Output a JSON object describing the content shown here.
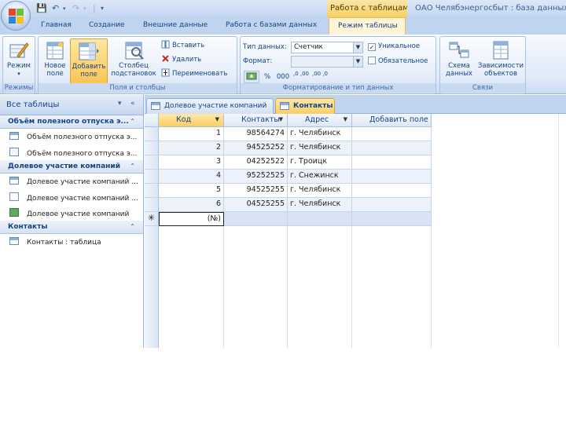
{
  "title_bar": {
    "context_title": "Работа с таблицами",
    "app_title": "ОАО Челябэнергосбыт : база данных"
  },
  "ribbon_tabs": [
    "Главная",
    "Создание",
    "Внешние данные",
    "Работа с базами данных"
  ],
  "active_tab": "Режим таблицы",
  "groups": {
    "views": {
      "label": "Режимы",
      "mode_button": "Режим"
    },
    "fields": {
      "label": "Поля и столбцы",
      "new_field_1": "Новое",
      "new_field_2": "поле",
      "add_field_1": "Добавить",
      "add_field_2": "поле",
      "lookup_1": "Столбец",
      "lookup_2": "подстановок",
      "insert": "Вставить",
      "delete": "Удалить",
      "rename": "Переименовать"
    },
    "formatting": {
      "label": "Форматирование и тип данных",
      "datatype_label": "Тип данных:",
      "datatype_value": "Счетчик",
      "format_label": "Формат:",
      "format_value": "",
      "unique_label": "Уникальное",
      "unique_checked": true,
      "required_label": "Обязательное",
      "required_checked": false,
      "fmt_buttons": [
        "%",
        "000",
        ",0 ,00",
        ",00 ,0"
      ]
    },
    "relationships": {
      "label": "Связи",
      "schema_1": "Схема",
      "schema_2": "данных",
      "deps_1": "Зависимости",
      "deps_2": "объектов"
    }
  },
  "nav": {
    "header": "Все таблицы",
    "groups": [
      {
        "title": "Объём полезного отпуска э...",
        "items": [
          "Объём полезного отпуска э...",
          "Объём полезного отпуска э..."
        ]
      },
      {
        "title": "Долевое участие компаний",
        "items": [
          "Долевое участие компаний ...",
          "Долевое участие компаний ...",
          "Долевое участие компаний"
        ]
      },
      {
        "title": "Контакты",
        "items": [
          "Контакты : таблица"
        ]
      }
    ]
  },
  "doc_tabs": [
    "Долевое участие компаний",
    "Контакты"
  ],
  "active_doc_tab": "Контакты",
  "table": {
    "columns": [
      "Код",
      "Контакты",
      "Адрес",
      "Добавить поле"
    ],
    "rows": [
      [
        "1",
        "98564274",
        "г. Челябинск"
      ],
      [
        "2",
        "94525252",
        "г. Челябинск"
      ],
      [
        "3",
        "04252522",
        "г. Троицк"
      ],
      [
        "4",
        "95252525",
        "г. Снежинск"
      ],
      [
        "5",
        "94525255",
        "г. Челябинск"
      ],
      [
        "6",
        "04525255",
        "г. Челябинск"
      ]
    ],
    "new_row_marker": "✳",
    "new_row_value": "(№)"
  },
  "colors": {
    "ribbon_blue": "#bfd4ef",
    "selected_orange": "#f9cd63",
    "text_blue": "#15428b"
  }
}
